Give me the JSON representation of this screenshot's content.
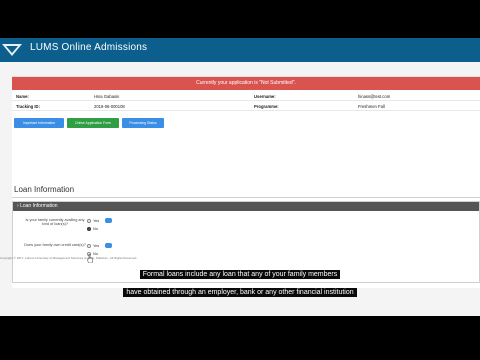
{
  "header": {
    "title": "LUMS Online Admissions"
  },
  "alert": {
    "text": "Currently your application is \"Not Submitted\"."
  },
  "info": {
    "name_label": "Name:",
    "name_value": "Hina Gabasin",
    "username_label": "Username:",
    "username_value": "hinass@test.com",
    "tracking_label": "Tracking ID:",
    "tracking_value": "2018-06-000108",
    "programme_label": "Programme:",
    "programme_value": "Freshmen Fall"
  },
  "buttons": {
    "important": "Important Information",
    "online_form": "Online Application Form",
    "processing": "Processing Status"
  },
  "colors": {
    "header": "#0c5e8c",
    "alert": "#d9534f",
    "btn_blue": "#3a8ee6",
    "btn_green": "#2f9e44"
  },
  "loan": {
    "section_title": "Loan Information",
    "box_title": "Loan Information",
    "q1": "Is your family currently availing any kind of loan(s)?",
    "q2": "Does your family own credit card(s)?",
    "yes": "Yes",
    "no": "No"
  },
  "footer": {
    "copyright": "Copyright © 2017, Lahore University of Management Sciences (LUMS). Pakistan - All Rights Reserved."
  },
  "caption": {
    "line1": "Formal loans include any loan that any of your family members",
    "line2": "have obtained through an employer, bank or any other financial institution"
  }
}
